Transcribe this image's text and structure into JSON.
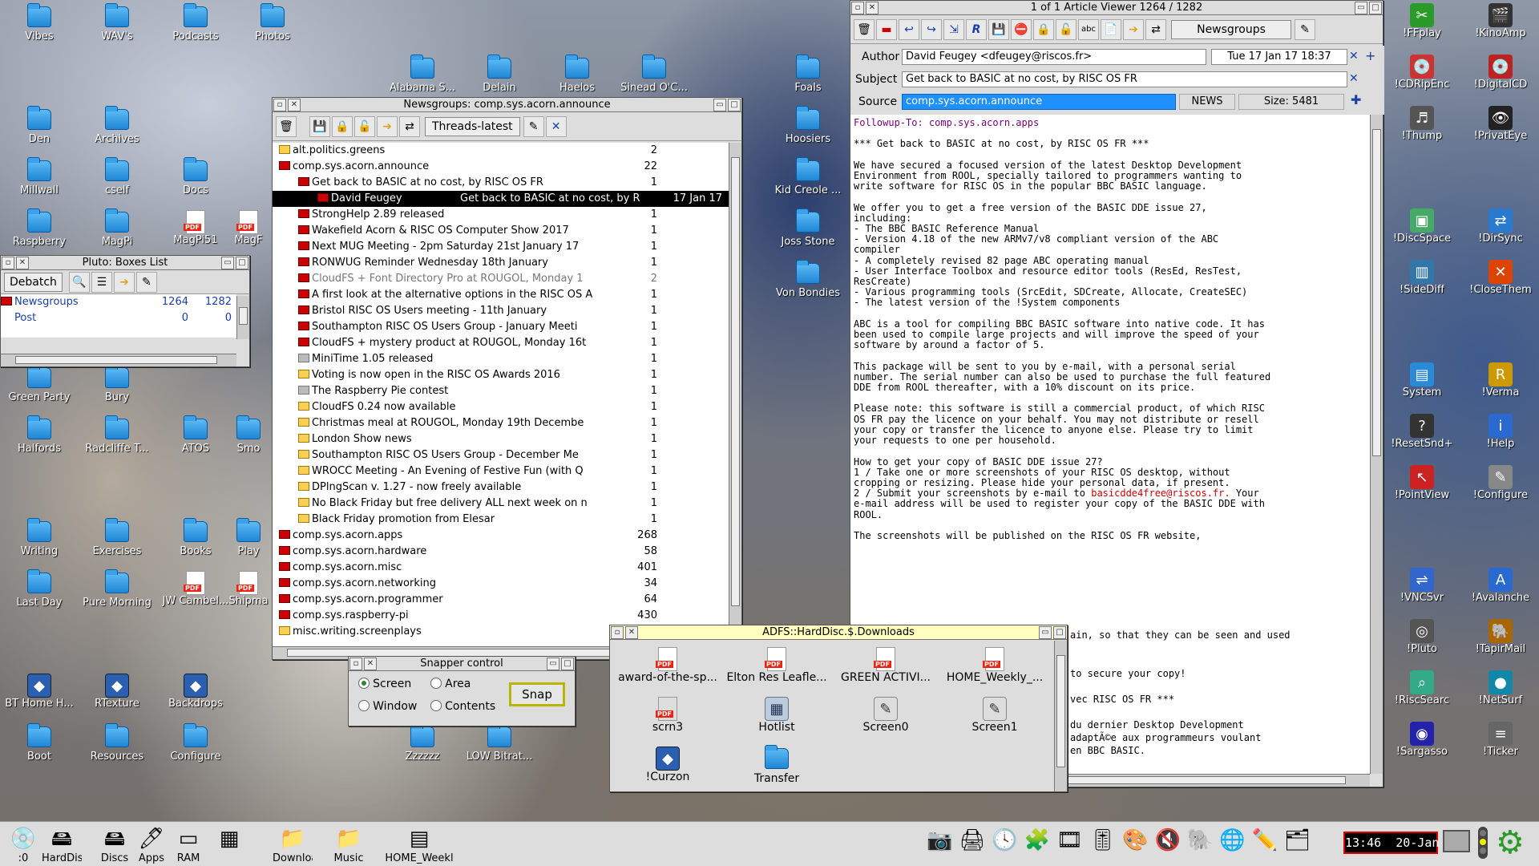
{
  "desktop_icons_left": [
    {
      "label": "Vibes",
      "kind": "folder"
    },
    {
      "label": "WAV's",
      "kind": "folder"
    },
    {
      "label": "Podcasts",
      "kind": "folder"
    },
    {
      "label": "Photos",
      "kind": "folder"
    },
    {
      "label": "Den",
      "kind": "folder"
    },
    {
      "label": "Archives",
      "kind": "folder"
    },
    {
      "label": "Millwall",
      "kind": "folder"
    },
    {
      "label": "cself",
      "kind": "folder"
    },
    {
      "label": "Docs",
      "kind": "folder"
    },
    {
      "label": "Raspberry",
      "kind": "folder"
    },
    {
      "label": "MagPi",
      "kind": "folder"
    },
    {
      "label": "MagPi51",
      "kind": "pdf"
    },
    {
      "label": "MagF",
      "kind": "pdf"
    },
    {
      "label": "Green Party",
      "kind": "folder"
    },
    {
      "label": "Bury",
      "kind": "folder"
    },
    {
      "label": "Halfords",
      "kind": "folder"
    },
    {
      "label": "Radcliffe T...",
      "kind": "folder"
    },
    {
      "label": "ATOS",
      "kind": "folder"
    },
    {
      "label": "Smo",
      "kind": "folder"
    },
    {
      "label": "Writing",
      "kind": "folder"
    },
    {
      "label": "Exercises",
      "kind": "folder"
    },
    {
      "label": "Books",
      "kind": "folder"
    },
    {
      "label": "Play",
      "kind": "folder"
    },
    {
      "label": "Last Day",
      "kind": "folder"
    },
    {
      "label": "Pure Morning",
      "kind": "folder"
    },
    {
      "label": "JW Cambel...",
      "kind": "pdf"
    },
    {
      "label": "Shipma",
      "kind": "pdf"
    },
    {
      "label": "BT Home H...",
      "kind": "app"
    },
    {
      "label": "RTexture",
      "kind": "app"
    },
    {
      "label": "Backdrops",
      "kind": "app"
    },
    {
      "label": "Boot",
      "kind": "folder"
    },
    {
      "label": "Resources",
      "kind": "folder"
    },
    {
      "label": "Configure",
      "kind": "folder"
    },
    {
      "label": "Alabama S...",
      "kind": "folder"
    },
    {
      "label": "Delain",
      "kind": "folder"
    },
    {
      "label": "Haelos",
      "kind": "folder"
    },
    {
      "label": "Sinead O'C...",
      "kind": "folder"
    },
    {
      "label": "Foals",
      "kind": "folder"
    },
    {
      "label": "Hoosiers",
      "kind": "folder"
    },
    {
      "label": "Kid Creole ...",
      "kind": "folder"
    },
    {
      "label": "Joss Stone",
      "kind": "folder"
    },
    {
      "label": "Von Bondies",
      "kind": "folder"
    },
    {
      "label": "Zzzzzz",
      "kind": "folder"
    },
    {
      "label": "LOW Bitrat...",
      "kind": "folder"
    }
  ],
  "desktop_icons_right": [
    "!FFplay",
    "!KinoAmp",
    "!CDRipEnc",
    "!DigitalCD",
    "!Thump",
    "!PrivatEye",
    "!DiscSpace",
    "!DirSync",
    "!SideDiff",
    "!CloseThem",
    "System",
    "!Verma",
    "!ResetSnd+",
    "!Help",
    "!PointView",
    "!Configure",
    "!VNCSvr",
    "!Avalanche",
    "!Pluto",
    "!TapirMail",
    "!RiscSearc",
    "!NetSurf",
    "!Sargasso",
    "!Ticker"
  ],
  "pluto": {
    "title": "Pluto:  Boxes List",
    "debatch": "Debatch",
    "rows": [
      {
        "name": "Newsgroups",
        "a": "1264",
        "b": "1282"
      },
      {
        "name": "Post",
        "a": "0",
        "b": "0"
      }
    ]
  },
  "newsgroups": {
    "title": "Newsgroups:  comp.sys.acorn.announce",
    "sort": "Threads-latest",
    "rows": [
      {
        "t": "alt.politics.greens",
        "n": "2",
        "f": "env",
        "i": 0
      },
      {
        "t": "comp.sys.acorn.announce",
        "n": "22",
        "f": "red",
        "i": 0
      },
      {
        "t": "Get back to BASIC at no cost, by RISC OS FR",
        "n": "1",
        "f": "red",
        "i": 1
      },
      {
        "t": "David Feugey",
        "d": "Get back to BASIC at no cost, by R",
        "date": "17 Jan 17",
        "f": "red",
        "i": 2,
        "sel": true
      },
      {
        "t": "StrongHelp 2.89 released",
        "n": "1",
        "f": "red",
        "i": 1
      },
      {
        "t": "Wakefield Acorn & RISC OS Computer Show 2017",
        "n": "1",
        "f": "red",
        "i": 1
      },
      {
        "t": "Next MUG Meeting - 2pm Saturday 21st January 17",
        "n": "1",
        "f": "red",
        "i": 1
      },
      {
        "t": "RONWUG Reminder Wednesday 18th January",
        "n": "1",
        "f": "red",
        "i": 1
      },
      {
        "t": "CloudFS + Font Directory Pro at ROUGOL, Monday 1",
        "n": "2",
        "f": "red",
        "i": 1,
        "dim": true
      },
      {
        "t": "A first look at the alternative options in the RISC OS A",
        "n": "1",
        "f": "red",
        "i": 1
      },
      {
        "t": "Bristol RISC OS Users meeting - 11th January",
        "n": "1",
        "f": "red",
        "i": 1
      },
      {
        "t": "Southampton RISC OS Users Group - January Meeti",
        "n": "1",
        "f": "red",
        "i": 1
      },
      {
        "t": "CloudFS + mystery product at ROUGOL, Monday 16t",
        "n": "1",
        "f": "red",
        "i": 1
      },
      {
        "t": "MiniTime 1.05 released",
        "n": "1",
        "f": "gray",
        "i": 1
      },
      {
        "t": "Voting is now open in the RISC OS Awards 2016",
        "n": "1",
        "f": "env",
        "i": 1
      },
      {
        "t": "The Raspberry Pie contest",
        "n": "1",
        "f": "gray",
        "i": 1
      },
      {
        "t": "CloudFS 0.24 now available",
        "n": "1",
        "f": "env",
        "i": 1
      },
      {
        "t": "Christmas meal at ROUGOL, Monday 19th Decembe",
        "n": "1",
        "f": "env",
        "i": 1
      },
      {
        "t": "London Show news",
        "n": "1",
        "f": "env",
        "i": 1
      },
      {
        "t": "Southampton RISC OS Users Group - December Me",
        "n": "1",
        "f": "env",
        "i": 1
      },
      {
        "t": "WROCC Meeting - An Evening of Festive Fun (with Q",
        "n": "1",
        "f": "env",
        "i": 1
      },
      {
        "t": "DPlngScan v. 1.27 - now freely available",
        "n": "1",
        "f": "env",
        "i": 1
      },
      {
        "t": "No Black Friday but free delivery ALL next week on n",
        "n": "1",
        "f": "env",
        "i": 1
      },
      {
        "t": "Black Friday promotion from Elesar",
        "n": "1",
        "f": "env",
        "i": 1
      },
      {
        "t": "comp.sys.acorn.apps",
        "n": "268",
        "f": "red",
        "i": 0
      },
      {
        "t": "comp.sys.acorn.hardware",
        "n": "58",
        "f": "red",
        "i": 0
      },
      {
        "t": "comp.sys.acorn.misc",
        "n": "401",
        "f": "red",
        "i": 0
      },
      {
        "t": "comp.sys.acorn.networking",
        "n": "34",
        "f": "red",
        "i": 0
      },
      {
        "t": "comp.sys.acorn.programmer",
        "n": "64",
        "f": "red",
        "i": 0
      },
      {
        "t": "comp.sys.raspberry-pi",
        "n": "430",
        "f": "red",
        "i": 0
      },
      {
        "t": "misc.writing.screenplays",
        "n": "",
        "f": "env",
        "i": 0
      }
    ]
  },
  "viewer": {
    "title": "1 of 1    Article Viewer    1264 / 1282",
    "folder": "Newsgroups",
    "author_label": "Author",
    "author": "David Feugey <dfeugey@riscos.fr>",
    "date": "Tue 17 Jan 17 18:37",
    "subject_label": "Subject",
    "subject": "Get back to BASIC at no cost, by RISC OS FR",
    "source_label": "Source",
    "source": "comp.sys.acorn.announce",
    "type": "NEWS",
    "size": "Size: 5481",
    "followup": "Followup-To: comp.sys.acorn.apps",
    "body": "\n*** Get back to BASIC at no cost, by RISC OS FR ***\n\nWe have secured a focused version of the latest Desktop Development\nEnvironment from ROOL, specially tailored to programmers wanting to\nwrite software for RISC OS in the popular BBC BASIC language.\n\nWe offer you to get a free version of the BASIC DDE issue 27,\nincluding:\n- The BBC BASIC Reference Manual\n- Version 4.18 of the new ARMv7/v8 compliant version of the ABC\ncompiler\n- A completely revised 82 page ABC operating manual\n- User Interface Toolbox and resource editor tools (ResEd, ResTest,\nResCreate)\n- Various programming tools (SrcEdit, SDCreate, Allocate, CreateSEC)\n- The latest version of the !System components\n\nABC is a tool for compiling BBC BASIC software into native code. It has\nbeen used to compile large projects and will improve the speed of your\nsoftware by around a factor of 5.\n\nThis package will be sent to you by e-mail, with a personal serial\nnumber. The serial number can also be used to purchase the full featured\nDDE from ROOL thereafter, with a 10% discount on its price.\n\nPlease note: this software is still a commercial product, of which RISC\nOS FR pay the licence on your behalf. You may not distribute or resell\nyour copy or transfer the licence to anyone else. Please try to limit\nyour requests to one per household.\n\nHow to get your copy of BASIC DDE issue 27?\n1 / Take one or more screenshots of your RISC OS desktop, without\ncropping or resizing. Please hide your personal data, if present.\n2 / Submit your screenshots by e-mail to ",
    "email": "basicdde4free@riscos.fr.",
    "body2": " Your\ne-mail address will be used to register your copy of the BASIC DDE with\nROOL.\n\nThe screenshots will be published on the RISC OS FR website,\n",
    "tail": [
      "ain, so that they can be seen and used",
      "",
      "",
      "to secure your copy!",
      "",
      "vec RISC OS FR ***",
      "",
      "du dernier Desktop Development",
      "adaptÃ©e aux programmeurs voulant",
      "en BBC BASIC."
    ]
  },
  "downloads": {
    "title": "ADFS::HardDisc.$.Downloads",
    "items": [
      {
        "label": "award-of-the-sp...",
        "kind": "pdf"
      },
      {
        "label": "Elton Res Leafle...",
        "kind": "pdf"
      },
      {
        "label": "GREEN ACTIVI...",
        "kind": "pdf"
      },
      {
        "label": "HOME_Weekly_...",
        "kind": "pdf"
      },
      {
        "label": "scrn3",
        "kind": "jpeg"
      },
      {
        "label": "Hotlist",
        "kind": "file"
      },
      {
        "label": "Screen0",
        "kind": "sprite"
      },
      {
        "label": "Screen1",
        "kind": "sprite"
      },
      {
        "label": "!Curzon",
        "kind": "app"
      },
      {
        "label": "Transfer",
        "kind": "folder"
      }
    ]
  },
  "snapper": {
    "title": "Snapper control",
    "screen": "Screen",
    "area": "Area",
    "window": "Window",
    "contents": "Contents",
    "snap": "Snap"
  },
  "iconbar": {
    "left": [
      ":0",
      "HardDisc",
      "Discs",
      "Apps",
      "RAM",
      "",
      "Downloads",
      "Music",
      "HOME_Weekl"
    ],
    "clock": "13:46  20-Jan"
  }
}
